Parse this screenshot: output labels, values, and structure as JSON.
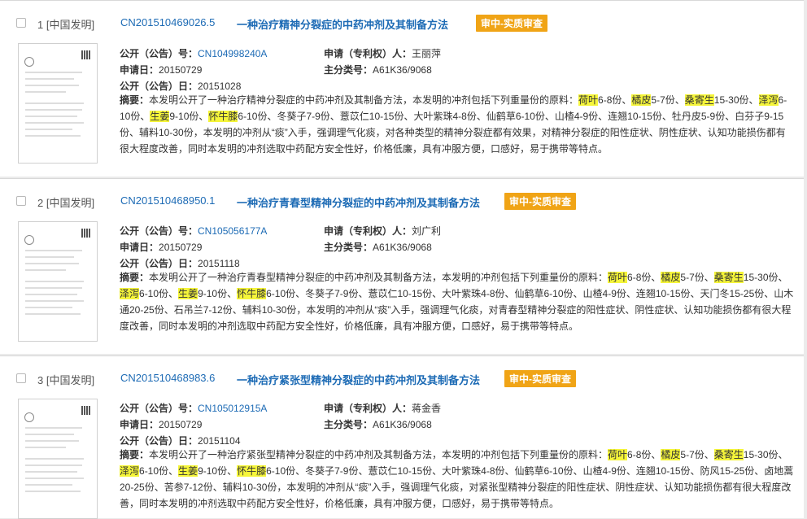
{
  "records": [
    {
      "index_label": "1 [中国发明]",
      "app_no": "CN201510469026.5",
      "title": "一种治疗精神分裂症的中药冲剂及其制备方法",
      "status": "审中-实质审查",
      "pub_label": "公开（公告）号：",
      "pub_no": "CN104998240A",
      "applicant_label": "申请（专利权）人：",
      "applicant": "王丽萍",
      "app_date_label": "申请日：",
      "app_date": "20150729",
      "ipc_label": "主分类号：",
      "ipc": "A61K36/9068",
      "pub_date_label": "公开（公告）日：",
      "pub_date": "20151028",
      "abstract_label": "摘要：",
      "abs_1": "本发明公开了一种治疗精神分裂症的中药冲剂及其制备方法，本发明的冲剂包括下列重量份的原料：",
      "hl_1": "荷叶",
      "abs_2": "6-8份、",
      "hl_2": "橘皮",
      "abs_3": "5-7份、",
      "hl_3": "桑寄生",
      "abs_4": "15-30份、",
      "hl_4": "泽泻",
      "abs_5": "6-10份、",
      "hl_5": "生姜",
      "abs_6": "9-10份、",
      "hl_6": "怀牛膝",
      "abs_7": "6-10份、冬葵子7-9份、薏苡仁10-15份、大叶紫珠4-8份、仙鹤草6-10份、山楂4-9份、连翘10-15份、牡丹皮5-9份、白芬子9-15份、辅料10-30份，本发明的冲剂从“痰”入手，强调理气化痰，对各种类型的精神分裂症都有效果，对精神分裂症的阳性症状、阴性症状、认知功能损伤都有很大程度改善，同时本发明的冲剂选取中药配方安全性好，价格低廉，具有冲服方便，口感好，易于携带等特点。"
    },
    {
      "index_label": "2 [中国发明]",
      "app_no": "CN201510468950.1",
      "title": "一种治疗青春型精神分裂症的中药冲剂及其制备方法",
      "status": "审中-实质审查",
      "pub_label": "公开（公告）号：",
      "pub_no": "CN105056177A",
      "applicant_label": "申请（专利权）人：",
      "applicant": "刘广利",
      "app_date_label": "申请日：",
      "app_date": "20150729",
      "ipc_label": "主分类号：",
      "ipc": "A61K36/9068",
      "pub_date_label": "公开（公告）日：",
      "pub_date": "20151118",
      "abstract_label": "摘要：",
      "abs_1": "本发明公开了一种治疗青春型精神分裂症的中药冲剂及其制备方法，本发明的冲剂包括下列重量份的原料：",
      "hl_1": "荷叶",
      "abs_2": "6-8份、",
      "hl_2": "橘皮",
      "abs_3": "5-7份、",
      "hl_3": "桑寄生",
      "abs_4": "15-30份、",
      "hl_4": "泽泻",
      "abs_5": "6-10份、",
      "hl_5": "生姜",
      "abs_6": "9-10份、",
      "hl_6": "怀牛膝",
      "abs_7": "6-10份、冬葵子7-9份、薏苡仁10-15份、大叶紫珠4-8份、仙鹤草6-10份、山楂4-9份、连翘10-15份、天门冬15-25份、山木通20-25份、石吊兰7-12份、辅料10-30份，本发明的冲剂从“痰”入手，强调理气化痰，对青春型精神分裂症的阳性症状、阴性症状、认知功能损伤都有很大程度改善，同时本发明的冲剂选取中药配方安全性好，价格低廉，具有冲服方便，口感好，易于携带等特点。"
    },
    {
      "index_label": "3 [中国发明]",
      "app_no": "CN201510468983.6",
      "title": "一种治疗紧张型精神分裂症的中药冲剂及其制备方法",
      "status": "审中-实质审查",
      "pub_label": "公开（公告）号：",
      "pub_no": "CN105012915A",
      "applicant_label": "申请（专利权）人：",
      "applicant": "蒋金香",
      "app_date_label": "申请日：",
      "app_date": "20150729",
      "ipc_label": "主分类号：",
      "ipc": "A61K36/9068",
      "pub_date_label": "公开（公告）日：",
      "pub_date": "20151104",
      "abstract_label": "摘要：",
      "abs_1": "本发明公开了一种治疗紧张型精神分裂症的中药冲剂及其制备方法，本发明的冲剂包括下列重量份的原料：",
      "hl_1": "荷叶",
      "abs_2": "6-8份、",
      "hl_2": "橘皮",
      "abs_3": "5-7份、",
      "hl_3": "桑寄生",
      "abs_4": "15-30份、",
      "hl_4": "泽泻",
      "abs_5": "6-10份、",
      "hl_5": "生姜",
      "abs_6": "9-10份、",
      "hl_6": "怀牛膝",
      "abs_7": "6-10份、冬葵子7-9份、薏苡仁10-15份、大叶紫珠4-8份、仙鹤草6-10份、山楂4-9份、连翘10-15份、防风15-25份、卤地蒿20-25份、苦参7-12份、辅料10-30份，本发明的冲剂从“痰”入手，强调理气化痰，对紧张型精神分裂症的阳性症状、阴性症状、认知功能损伤都有很大程度改善，同时本发明的冲剂选取中药配方安全性好，价格低廉，具有冲服方便，口感好，易于携带等特点。"
    }
  ],
  "colors": {
    "link": "#1d6bb5",
    "badge": "#f0a416",
    "highlight": "#f5f53a"
  }
}
